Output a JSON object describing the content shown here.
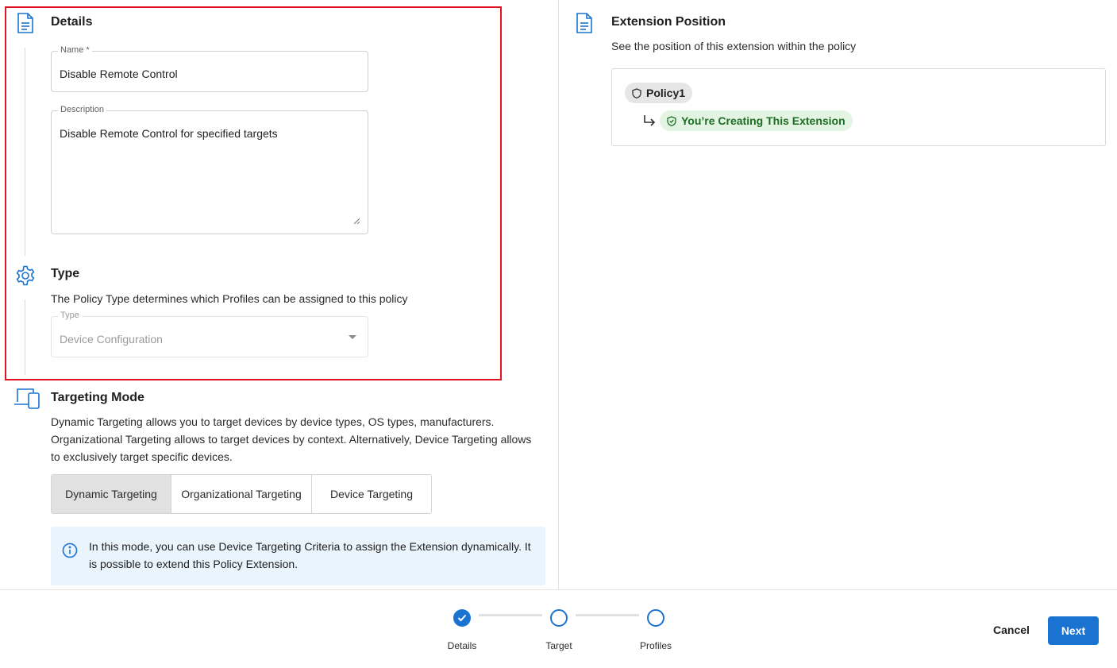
{
  "details": {
    "title": "Details",
    "name_label": "Name *",
    "name_value": "Disable Remote Control",
    "description_label": "Description",
    "description_value": "Disable Remote Control for specified targets"
  },
  "type": {
    "title": "Type",
    "description": "The Policy Type determines which Profiles can be assigned to this policy",
    "field_label": "Type",
    "field_value": "Device Configuration"
  },
  "targeting": {
    "title": "Targeting Mode",
    "description": "Dynamic Targeting allows you to target devices by device types, OS types, manufacturers. Organizational Targeting allows to target devices by context. Alternatively, Device Targeting allows to exclusively target specific devices.",
    "options": [
      "Dynamic Targeting",
      "Organizational Targeting",
      "Device Targeting"
    ],
    "selected": "Dynamic Targeting",
    "info": "In this mode, you can use Device Targeting Criteria to assign the Extension dynamically. It is possible to extend this Policy Extension."
  },
  "extension_position": {
    "title": "Extension Position",
    "description": "See the position of this extension within the policy",
    "policy_chip": "Policy1",
    "creating_chip": "You’re Creating This Extension"
  },
  "stepper": {
    "steps": [
      "Details",
      "Target",
      "Profiles"
    ]
  },
  "actions": {
    "cancel": "Cancel",
    "next": "Next"
  },
  "colors": {
    "accent": "#1a73d0",
    "highlight_border": "#e0141e",
    "info_bg": "#eaf4fc",
    "success_chip_bg": "#e3f4e3",
    "success_chip_text": "#1b6e24"
  }
}
